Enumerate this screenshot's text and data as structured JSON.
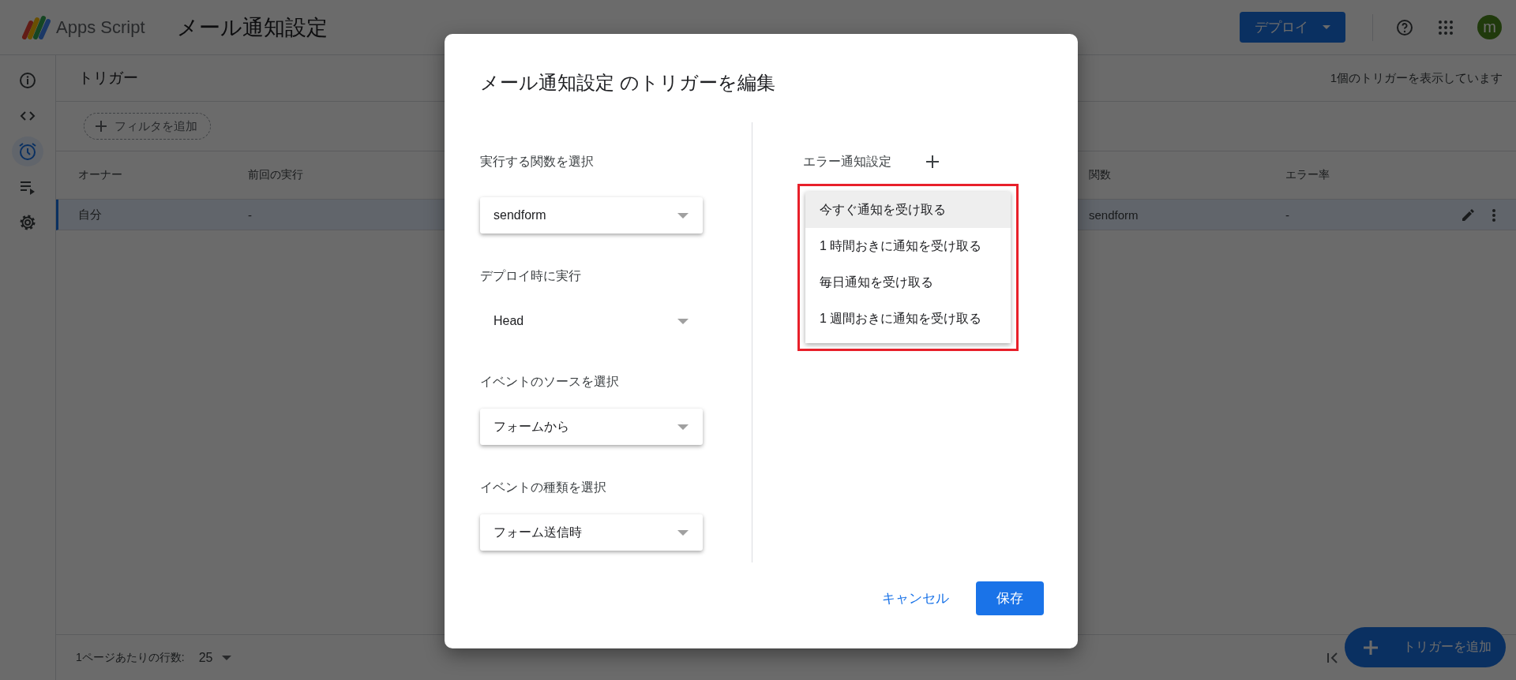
{
  "app": {
    "name": "Apps Script",
    "project": "メール通知設定",
    "deploy_button": "デプロイ",
    "avatar": "m"
  },
  "rail": [
    {
      "kind": "info",
      "selected": false
    },
    {
      "kind": "code",
      "selected": false
    },
    {
      "kind": "clock",
      "selected": true
    },
    {
      "kind": "runs",
      "selected": false
    },
    {
      "kind": "settings",
      "selected": false
    }
  ],
  "page": {
    "title": "トリガー",
    "count": "1個のトリガーを表示しています",
    "filter_button": "フィルタを追加"
  },
  "table": {
    "columns": [
      "オーナー",
      "前回の実行",
      "関数",
      "エラー率"
    ],
    "rows": [
      {
        "cells": [
          "自分",
          "-",
          "sendform",
          "-"
        ],
        "selected": true
      }
    ]
  },
  "footer": {
    "rows_per_page_label": "1ページあたりの行数:",
    "rows_per_page": "25"
  },
  "fab": "トリガーを追加",
  "dialog": {
    "title": "メール通知設定 のトリガーを編集",
    "fields": [
      {
        "label": "実行する関数を選択",
        "value": "sendform",
        "kind": "select"
      },
      {
        "label": "デプロイ時に実行",
        "value": "Head",
        "kind": "plain"
      },
      {
        "label": "イベントのソースを選択",
        "value": "フォームから",
        "kind": "select"
      },
      {
        "label": "イベントの種類を選択",
        "value": "フォーム送信時",
        "kind": "select"
      }
    ],
    "error_notification": {
      "label": "エラー通知設定",
      "highlighted": true,
      "options": [
        {
          "label": "今すぐ通知を受け取る",
          "selected": true
        },
        {
          "label": "1 時間おきに通知を受け取る",
          "selected": false
        },
        {
          "label": "毎日通知を受け取る",
          "selected": false
        },
        {
          "label": "1 週間おきに通知を受け取る",
          "selected": false
        }
      ]
    },
    "cancel": "キャンセル",
    "save": "保存"
  }
}
